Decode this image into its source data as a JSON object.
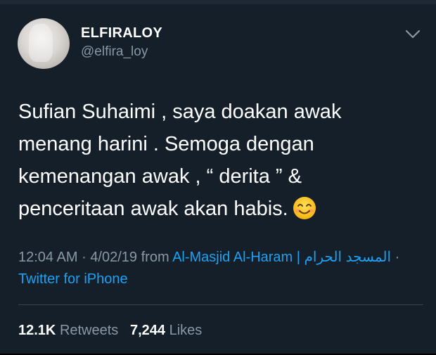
{
  "user": {
    "display_name": "ELFIRALOY",
    "handle": "@elfira_loy"
  },
  "tweet": {
    "text": "Sufian Suhaimi , saya doakan awak\nmenang harini . Semoga dengan\nkemenangan awak  , “ derita ” &\npenceritaan awak akan habis.",
    "emoji": "smiling-face-icon"
  },
  "meta": {
    "time": "12:04 AM",
    "date": "4/02/19",
    "from_label": "from",
    "location": "Al-Masjid Al-Haram | المسجد الحرام",
    "client": "Twitter for iPhone",
    "separator": "·"
  },
  "stats": {
    "retweets_count": "12.1K",
    "retweets_label": "Retweets",
    "likes_count": "7,244",
    "likes_label": "Likes"
  },
  "colors": {
    "background": "#151f2a",
    "secondary_text": "#8899a6",
    "link": "#1da1f2"
  }
}
